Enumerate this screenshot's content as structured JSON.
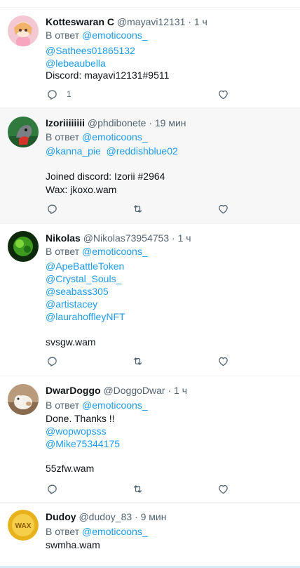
{
  "reply_prefix": "В ответ",
  "tweets": [
    {
      "name": "Kotteswaran C",
      "handle": "@mayavi12131",
      "dot": "·",
      "time": "1 ч",
      "reply_to": "@emoticoons_",
      "mentions": [
        "@Sathees01865132",
        "@lebeaubella"
      ],
      "body_lines": [
        "Discord: mayavi12131#9511"
      ],
      "reply_count": "1"
    },
    {
      "name": "Izoriiiiiiii",
      "handle": "@phdibonete",
      "dot": "·",
      "time": "19 мин",
      "reply_to": "@emoticoons_",
      "mention_line": [
        "@kanna_pie",
        "@reddishblue02"
      ],
      "body_lines": [
        "Joined discord: Izorii #2964",
        "Wax: jkoxo.wam"
      ]
    },
    {
      "name": "Nikolas",
      "handle": "@Nikolas73954753",
      "dot": "·",
      "time": "1 ч",
      "reply_to": "@emoticoons_",
      "mentions": [
        "@ApeBattleToken",
        "@Crystal_Souls_",
        "@seabass305",
        "@artistacey",
        "@laurahoffleyNFT"
      ],
      "body_lines": [
        "svsgw.wam"
      ]
    },
    {
      "name": "DwarDoggo",
      "handle": "@DoggoDwar",
      "dot": "·",
      "time": "1 ч",
      "reply_to": "@emoticoons_",
      "body_lines": [
        "Done. Thanks !!",
        "55zfw.wam"
      ],
      "mentions": [
        "@wopwopsss",
        "@Mike75344175"
      ]
    },
    {
      "name": "Dudoy",
      "handle": "@dudoy_83",
      "dot": "·",
      "time": "9 мин",
      "reply_to": "@emoticoons_",
      "body_lines": [
        "swmha.wam"
      ]
    }
  ],
  "avatar_badge_text": "WAX",
  "colors": {
    "link": "#1d9bf0",
    "muted": "#536471",
    "text": "#0f1419",
    "hover_bg": "#f7f7f7"
  },
  "icons": [
    "reply-icon",
    "retweet-icon",
    "like-icon"
  ]
}
